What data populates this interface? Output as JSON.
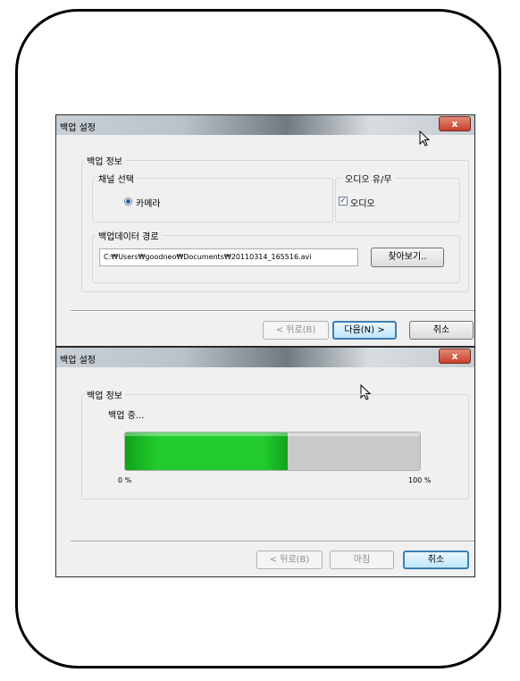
{
  "backup_settings_window": {
    "title": "백업 설정",
    "close_label": "x",
    "group_backup_info": "백업 정보",
    "group_channel_select": "채널 선택",
    "radio_camera_label": "카메라",
    "group_audio": "오디오 유/무",
    "checkbox_audio_label": "오디오",
    "checkbox_audio_checked": true,
    "group_backup_path": "백업데이터 경로",
    "path_value": "C:₩Users₩goodneo₩Documents₩20110314_165516.avi",
    "browse_button": "찾아보기..",
    "back_button": "< 뒤로(B)",
    "next_button": "다음(N) >",
    "cancel_button": "취소"
  },
  "backup_progress_window": {
    "title": "백업 설정",
    "close_label": "x",
    "group_backup_info": "백업 정보",
    "status_text": "백업 중...",
    "progress_percent": 55,
    "min_label": "0 %",
    "max_label": "100 %",
    "back_button": "< 뒤로(B)",
    "finish_button": "마침",
    "cancel_button": "취소"
  },
  "colors": {
    "progress_green": "#22cc2e",
    "close_red": "#c8402c",
    "default_button_border": "#3c7fb1"
  },
  "icons": [
    "cursor-arrow-icon",
    "close-icon"
  ]
}
